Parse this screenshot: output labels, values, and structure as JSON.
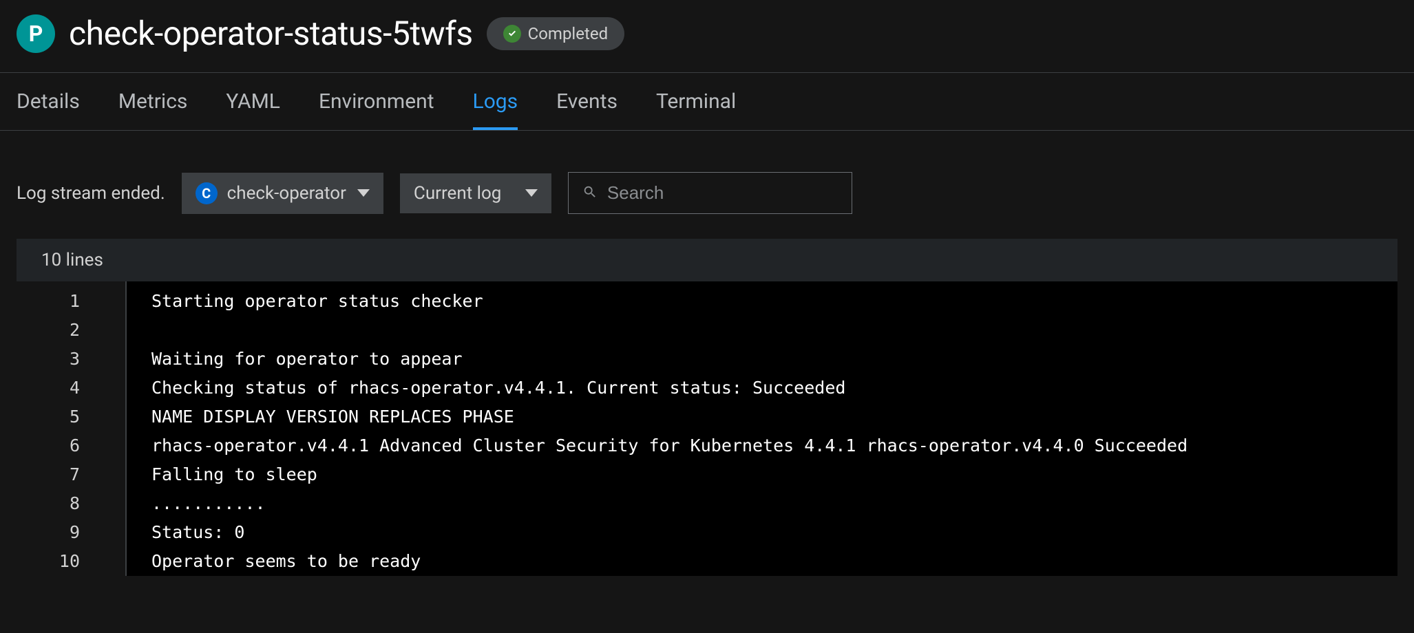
{
  "header": {
    "pod_icon_letter": "P",
    "title": "check-operator-status-5twfs",
    "status_label": "Completed"
  },
  "tabs": [
    {
      "label": "Details",
      "active": false
    },
    {
      "label": "Metrics",
      "active": false
    },
    {
      "label": "YAML",
      "active": false
    },
    {
      "label": "Environment",
      "active": false
    },
    {
      "label": "Logs",
      "active": true
    },
    {
      "label": "Events",
      "active": false
    },
    {
      "label": "Terminal",
      "active": false
    }
  ],
  "log_controls": {
    "stream_status": "Log stream ended.",
    "container_icon_letter": "C",
    "container_selected": "check-operator",
    "log_scope_selected": "Current log",
    "search_placeholder": "Search"
  },
  "log_summary": "10 lines",
  "log_lines": [
    "Starting operator status checker",
    "",
    "Waiting for operator to appear",
    "Checking status of rhacs-operator.v4.4.1. Current status: Succeeded",
    "NAME DISPLAY VERSION REPLACES PHASE",
    "rhacs-operator.v4.4.1 Advanced Cluster Security for Kubernetes 4.4.1 rhacs-operator.v4.4.0 Succeeded",
    "Falling to sleep",
    "...........",
    "Status: 0",
    "Operator seems to be ready"
  ]
}
